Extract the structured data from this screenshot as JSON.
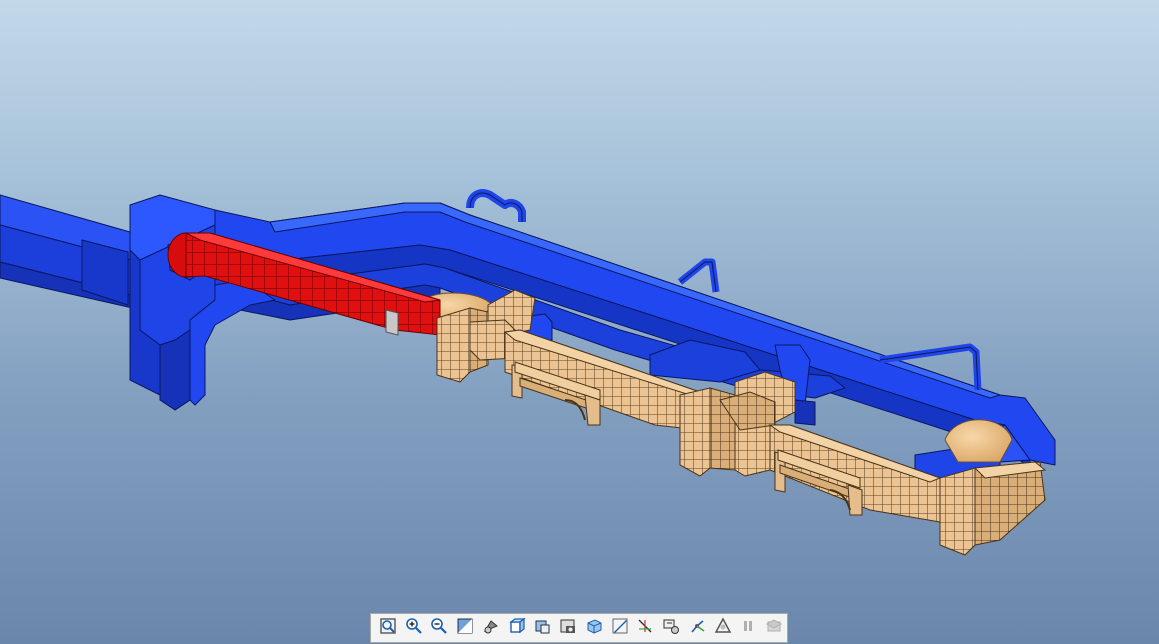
{
  "viewport": {
    "model": "piping-and-pipe-rack-assembly",
    "colors": {
      "duct": "#1f44e8",
      "duct_dark": "#0f2fc2",
      "duct_light": "#3560ff",
      "highlight": "#e01010",
      "highlight_dark": "#8a0000",
      "grid_block": "#ecc493",
      "grid_block_dark": "#8a6c48",
      "tank": "#f1c48f",
      "edge": "#0a1760"
    }
  },
  "toolbar": {
    "buttons": [
      {
        "name": "refit-icon",
        "active": true
      },
      {
        "name": "zoom-in-icon",
        "active": true
      },
      {
        "name": "zoom-out-icon",
        "active": true
      },
      {
        "name": "zoom-window-icon",
        "active": true
      },
      {
        "name": "repaint-icon",
        "active": true
      },
      {
        "name": "display-style-icon",
        "active": true
      },
      {
        "name": "saved-views-icon",
        "active": true
      },
      {
        "name": "view-manager-icon",
        "active": true
      },
      {
        "name": "perspective-icon",
        "active": true
      },
      {
        "name": "section-icon",
        "active": true
      },
      {
        "name": "datum-display-icon",
        "active": true
      },
      {
        "name": "annotation-display-icon",
        "active": true
      },
      {
        "name": "spin-center-icon",
        "active": true
      },
      {
        "name": "simplified-rep-icon",
        "active": true
      },
      {
        "name": "pause-icon",
        "active": false
      },
      {
        "name": "layer-icon",
        "active": false
      }
    ]
  }
}
